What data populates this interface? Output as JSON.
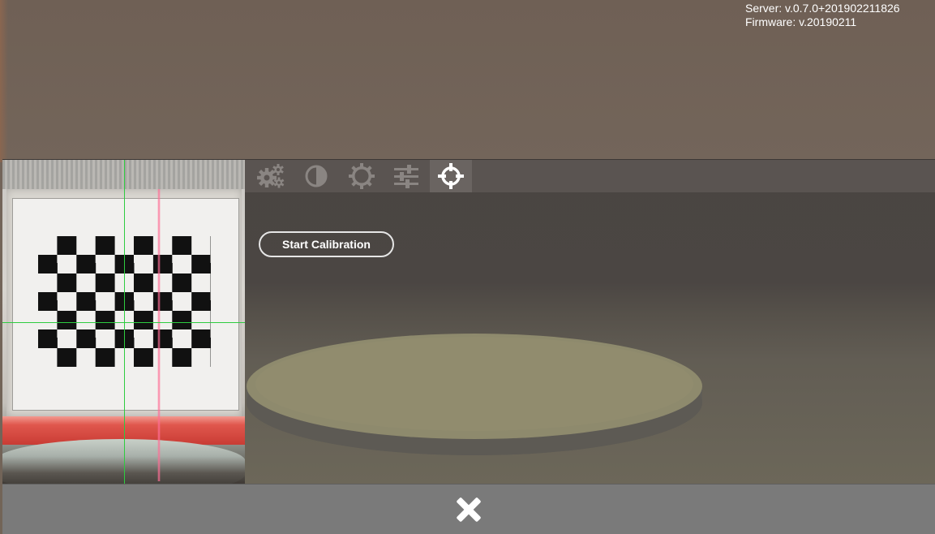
{
  "version": {
    "server": "Server: v.0.7.0+201902211826",
    "firmware": "Firmware: v.20190211"
  },
  "tabs": [
    {
      "icon": "gears-icon",
      "active": false
    },
    {
      "icon": "contrast-icon",
      "active": false
    },
    {
      "icon": "brightness-icon",
      "active": false
    },
    {
      "icon": "sliders-icon",
      "active": false
    },
    {
      "icon": "crosshair-icon",
      "active": true
    }
  ],
  "calibration": {
    "start_label": "Start Calibration"
  },
  "footer": {
    "close_icon": "close-icon"
  },
  "colors": {
    "background": "#72645a",
    "tabbar": "#5a5451",
    "active_tab": "#6a6461",
    "footer": "#7a7a7a",
    "guide_lines": "#2ecc40",
    "laser": "#ff6e96"
  }
}
